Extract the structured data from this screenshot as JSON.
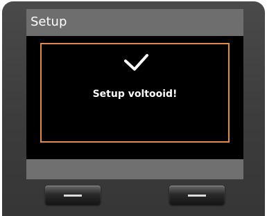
{
  "screen": {
    "title": "Setup",
    "message": "Setup voltooid!",
    "status_icon": "checkmark-icon"
  },
  "softkeys": {
    "left_icon": "dash-icon",
    "right_icon": "dash-icon"
  },
  "colors": {
    "title_bar": "#6e6e6e",
    "screen_background": "#000000",
    "message_border": "#e38a4b",
    "text": "#ffffff",
    "softkey_bar": "#707070",
    "bezel": "#3e3e3e"
  }
}
